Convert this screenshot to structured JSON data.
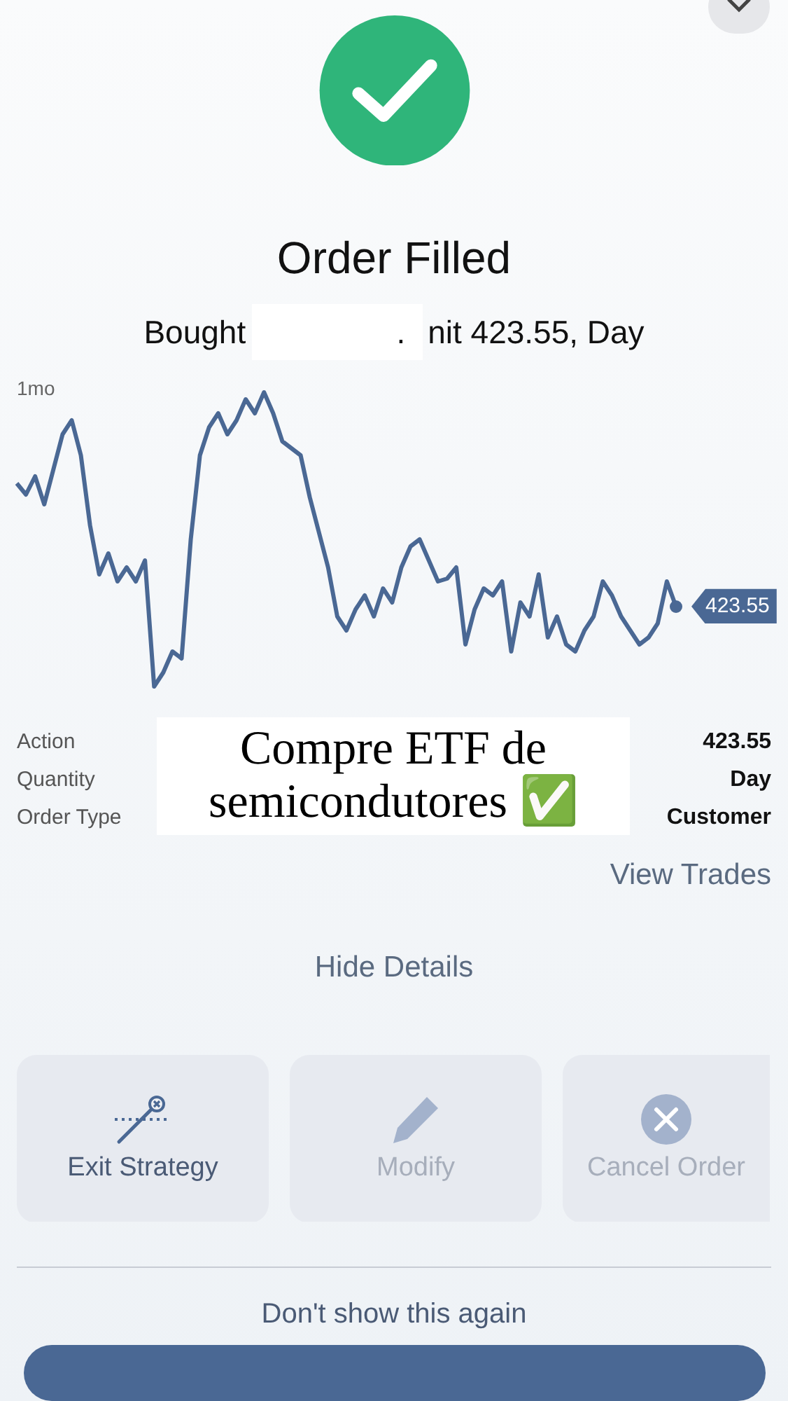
{
  "status": {
    "title": "Order Filled",
    "subtitle_before": "Bought",
    "subtitle_hidden_mark": ".",
    "subtitle_after": "nit 423.55, Day",
    "redacted": true
  },
  "chart": {
    "range": "1mo",
    "price_tag": "423.55"
  },
  "details": [
    {
      "label": "Action",
      "value": "423.55"
    },
    {
      "label": "Quantity",
      "value": "Day"
    },
    {
      "label": "Order Type",
      "value": "Customer"
    }
  ],
  "overlay_caption": {
    "text": "Compre ETF de semicondutores",
    "emoji": "✅"
  },
  "view_trades": "View Trades",
  "hide_details": "Hide Details",
  "actions": [
    {
      "label": "Exit Strategy",
      "kind": "exit",
      "disabled": false
    },
    {
      "label": "Modify",
      "kind": "modify",
      "disabled": true
    },
    {
      "label": "Cancel Order",
      "kind": "cancel",
      "disabled": true
    }
  ],
  "dont_show": "Don't show this again"
}
